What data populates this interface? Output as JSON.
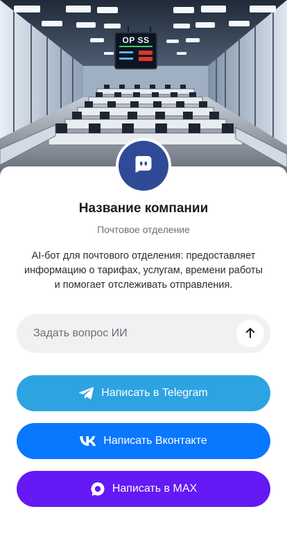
{
  "hero": {
    "sign_text": "OP SS",
    "icon": "post-office-hall-image"
  },
  "profile": {
    "avatar_icon": "chat-bot-icon",
    "company_name": "Название компании",
    "company_type": "Почтовое отделение",
    "description": "AI-бот для почтового отделения: предоставляет информацию о тарифах, услугам, времени работы и помогает отслеживать отправления."
  },
  "ask": {
    "placeholder": "Задать вопрос ИИ",
    "value": "",
    "send_icon": "arrow-up-icon"
  },
  "buttons": {
    "telegram": {
      "label": "Написать в Telegram",
      "icon": "telegram-icon",
      "color": "#2ea3e2"
    },
    "vk": {
      "label": "Написать Вконтакте",
      "icon": "vk-icon",
      "color": "#0a77ff"
    },
    "max": {
      "label": "Написать в MAX",
      "icon": "max-icon",
      "color": "#6419f5"
    }
  },
  "colors": {
    "avatar_bg": "#2f4b97",
    "input_bg": "#f1f1f3"
  }
}
